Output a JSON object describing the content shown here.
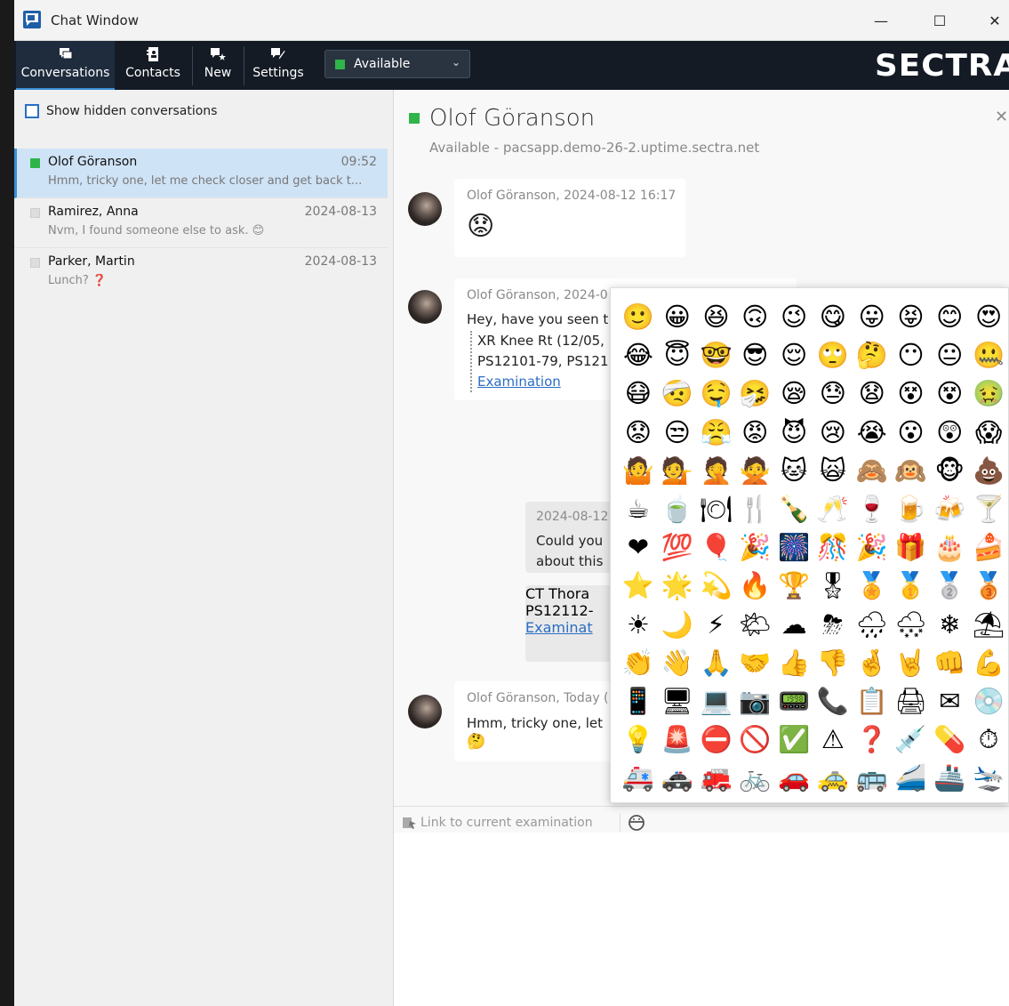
{
  "window": {
    "title": "Chat Window"
  },
  "toolbar": {
    "conversations": "Conversations",
    "contacts": "Contacts",
    "new": "New",
    "settings": "Settings",
    "status": "Available",
    "brand": "SECTRA"
  },
  "sidebar": {
    "show_hidden": "Show hidden conversations",
    "conversations": [
      {
        "name": "Olof Göranson",
        "time": "09:52",
        "preview": "Hmm, tricky one, let me check closer and get back t..."
      },
      {
        "name": "Ramirez, Anna",
        "time": "2024-08-13",
        "preview": "Nvm, I found someone else to ask. 😊"
      },
      {
        "name": "Parker, Martin",
        "time": "2024-08-13",
        "preview": "Lunch? ❓"
      }
    ]
  },
  "chat": {
    "contact_name": "Olof Göranson",
    "contact_status": "Available - pacsapp.demo-26-2.uptime.sectra.net",
    "messages": [
      {
        "meta": "Olof Göranson, 2024-08-12 16:17",
        "text": "😟"
      },
      {
        "meta": "Olof Göranson, 2024-0",
        "text": "Hey, have you seen t",
        "attach1": "XR Knee Rt (12/05,",
        "attach2": "PS12101-79, PS121",
        "attach_link": "Examination"
      },
      {
        "meta": "2024-08-12",
        "text1": "Could you",
        "text2": "about this",
        "attach1": "CT Thora",
        "attach2": "PS12112-",
        "attach_link": "Examinat"
      },
      {
        "meta": "Olof Göranson, Today (",
        "text": "Hmm, tricky one, let",
        "emoji": "🤔"
      }
    ],
    "link_exam": "Link to current examination"
  },
  "emoji_picker": {
    "emojis": [
      "🙂",
      "😀",
      "😆",
      "🙃",
      "😉",
      "😋",
      "😛",
      "😝",
      "😊",
      "😍",
      "😂",
      "😇",
      "🤓",
      "😎",
      "😌",
      "🙄",
      "🤔",
      "😶",
      "😐",
      "🤐",
      "😷",
      "🤕",
      "🤤",
      "🤧",
      "😪",
      "😓",
      "😧",
      "😵",
      "😵",
      "🤢",
      "😟",
      "😒",
      "😤",
      "😡",
      "😈",
      "😢",
      "😭",
      "😮",
      "😲",
      "😱",
      "🤷",
      "💁",
      "🤦",
      "🙅",
      "🐱",
      "🙀",
      "🙈",
      "🙉",
      "🐵",
      "💩",
      "☕",
      "🍵",
      "🍽",
      "🍴",
      "🍾",
      "🥂",
      "🍷",
      "🍺",
      "🍻",
      "🍸",
      "❤",
      "💯",
      "🎈",
      "🎉",
      "🎆",
      "🎊",
      "🎉",
      "🎁",
      "🎂",
      "🍰",
      "⭐",
      "🌟",
      "💫",
      "🔥",
      "🏆",
      "🎖",
      "🏅",
      "🥇",
      "🥈",
      "🥉",
      "☀",
      "🌙",
      "⚡",
      "🌤",
      "☁",
      "⛈",
      "🌧",
      "🌨",
      "❄",
      "⛱",
      "👏",
      "👋",
      "🙏",
      "🤝",
      "👍",
      "👎",
      "🤞",
      "🤘",
      "👊",
      "💪",
      "📱",
      "🖥",
      "💻",
      "📷",
      "📟",
      "📞",
      "📋",
      "🖨",
      "✉",
      "💿",
      "💡",
      "🚨",
      "⛔",
      "🚫",
      "✅",
      "⚠",
      "❓",
      "💉",
      "💊",
      "⏱",
      "🚑",
      "🚓",
      "🚒",
      "🚲",
      "🚗",
      "🚕",
      "🚌",
      "🚄",
      "🚢",
      "🛬"
    ]
  }
}
